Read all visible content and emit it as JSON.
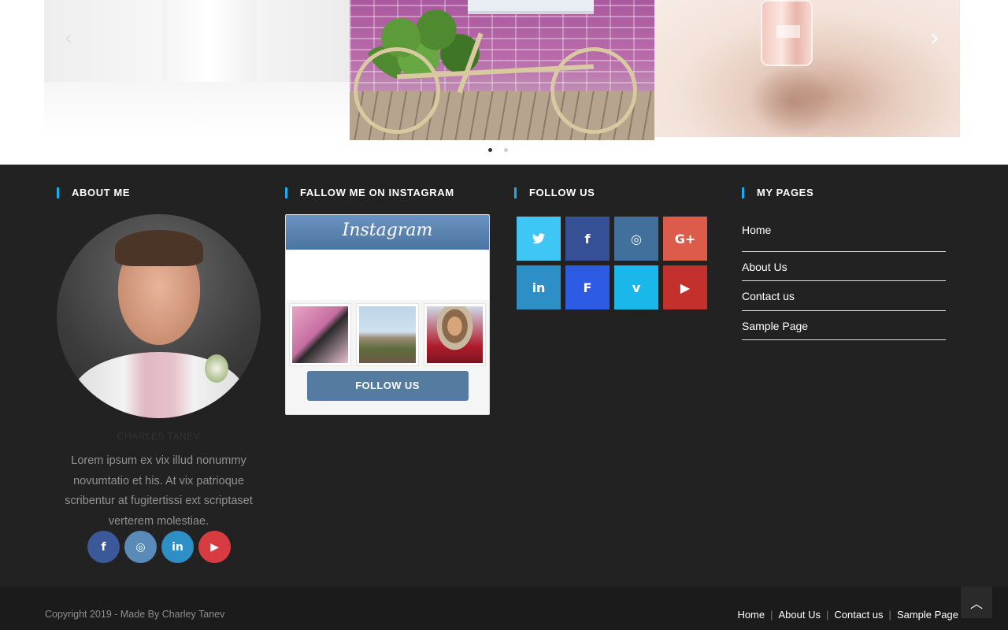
{
  "carousel": {
    "prev_icon": "chevron-left-icon",
    "next_icon": "chevron-right-icon",
    "slides": [
      "white-room-image",
      "bicycle-flowers-image",
      "perfume-bottle-image"
    ],
    "active_dot": 1,
    "dot_count": 2
  },
  "about": {
    "title": "ABOUT ME",
    "name": "CHARLES TANEV",
    "bio": "Lorem ipsum ex vix illud nonummy novumtatio et his. At vix patrioque scribentur at fugitertissi ext scriptaset verterem molestiae.",
    "social": [
      {
        "name": "facebook",
        "glyph": "f",
        "color": "#3b5998"
      },
      {
        "name": "instagram",
        "glyph": "◎",
        "color": "#3f729b"
      },
      {
        "name": "linkedin",
        "glyph": "in",
        "color": "#1e88c9"
      },
      {
        "name": "youtube",
        "glyph": "▶",
        "color": "#c4302b"
      }
    ]
  },
  "instagram": {
    "title": "FALLOW ME ON INSTAGRAM",
    "logo": "Instagram",
    "follow_label": "FOLLOW US"
  },
  "follow": {
    "title": "FOLLOW US",
    "buttons": [
      {
        "name": "twitter",
        "glyph": "🐦",
        "color": "#3ec7f5"
      },
      {
        "name": "facebook",
        "glyph": "f",
        "color": "#355094"
      },
      {
        "name": "instagram",
        "glyph": "◎",
        "color": "#40709b"
      },
      {
        "name": "google-plus",
        "glyph": "G+",
        "color": "#dd4b39"
      },
      {
        "name": "linkedin",
        "glyph": "in",
        "color": "#2e8fc6"
      },
      {
        "name": "foursquare",
        "glyph": "F",
        "color": "#2d5be3"
      },
      {
        "name": "vimeo",
        "glyph": "v",
        "color": "#1ab7ea"
      },
      {
        "name": "youtube",
        "glyph": "▶",
        "color": "#c4302b"
      }
    ]
  },
  "pages": {
    "title": "MY PAGES",
    "links": [
      "Home",
      "About Us",
      "Contact us",
      "Sample Page"
    ]
  },
  "bottom": {
    "copyright": "Copyright 2019 - Made By Charley Tanev",
    "menu": [
      "Home",
      "About Us",
      "Contact us",
      "Sample Page"
    ],
    "back_to_top_icon": "chevron-up-icon"
  }
}
